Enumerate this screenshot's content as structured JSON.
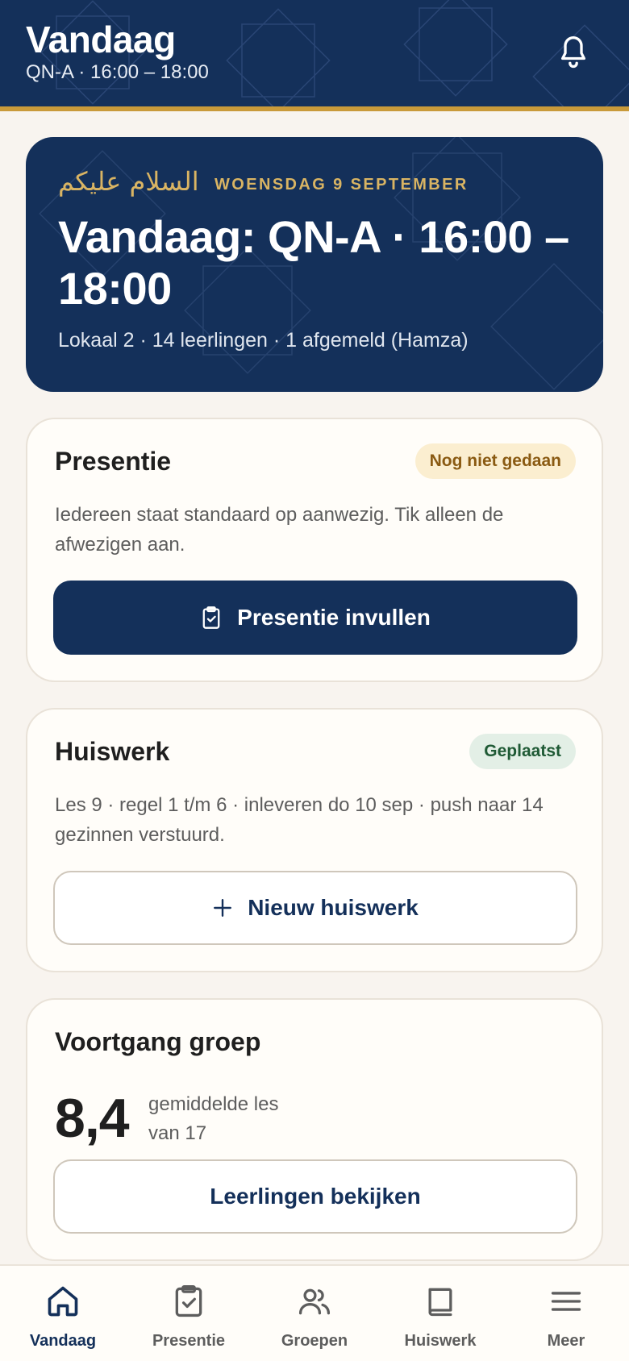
{
  "colors": {
    "navy": "#14305a",
    "gold": "#c99a3a",
    "gold_text": "#d9b463",
    "background": "#f8f4ef",
    "card": "#fffdf9",
    "warn_badge_bg": "#fbeed0",
    "ok_badge_bg": "#e3efe6"
  },
  "header": {
    "title": "Vandaag",
    "subtitle": "QN-A · 16:00 – 18:00",
    "bell_icon": "bell-icon"
  },
  "hero": {
    "greeting": "السلام عليكم",
    "date": "WOENSDAG 9 SEPTEMBER",
    "title": "Vandaag: QN-A · 16:00 – 18:00",
    "info": "Lokaal 2 · 14 leerlingen · 1 afgemeld (Hamza)"
  },
  "attendance": {
    "title": "Presentie",
    "badge": "Nog niet gedaan",
    "description": "Iedereen staat standaard op aanwezig. Tik alleen de afwezigen aan.",
    "button_label": "Presentie invullen",
    "button_icon": "clipboard-check-icon"
  },
  "homework": {
    "title": "Huiswerk",
    "badge": "Geplaatst",
    "description": "Les 9 · regel 1 t/m 6 · inleveren do 10 sep · push naar 14 gezinnen verstuurd.",
    "button_label": "Nieuw huiswerk",
    "button_icon": "plus-icon"
  },
  "progress": {
    "title": "Voortgang groep",
    "value": "8,4",
    "label_line1": "gemiddelde les",
    "label_line2": "van 17",
    "button_label": "Leerlingen bekijken"
  },
  "nav": {
    "items": [
      {
        "label": "Vandaag",
        "icon": "home-icon",
        "active": true
      },
      {
        "label": "Presentie",
        "icon": "clipboard-check-icon",
        "active": false
      },
      {
        "label": "Groepen",
        "icon": "users-icon",
        "active": false
      },
      {
        "label": "Huiswerk",
        "icon": "book-icon",
        "active": false
      },
      {
        "label": "Meer",
        "icon": "menu-icon",
        "active": false
      }
    ]
  }
}
